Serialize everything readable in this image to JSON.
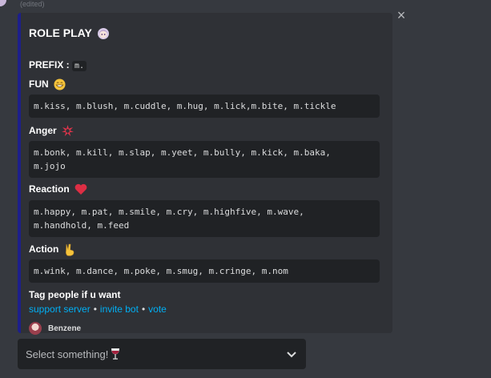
{
  "message": {
    "edited_label": "(edited)"
  },
  "embed": {
    "title": "ROLE PLAY",
    "prefix_label": "PREFIX :",
    "prefix_value": "m.",
    "fields": [
      {
        "name": "FUN",
        "value": "m.kiss, m.blush, m.cuddle, m.hug, m.lick,m.bite, m.tickle",
        "icon": "grinning-face-icon"
      },
      {
        "name": "Anger",
        "value": "m.bonk, m.kill, m.slap, m.yeet, m.bully, m.kick, m.baka,\nm.jojo",
        "icon": "anger-symbol-icon"
      },
      {
        "name": "Reaction",
        "value": "m.happy, m.pat, m.smile, m.cry, m.highfive, m.wave,\nm.handhold, m.feed",
        "icon": "red-heart-icon"
      },
      {
        "name": "Action",
        "value": "m.wink, m.dance, m.poke, m.smug, m.cringe, m.nom",
        "icon": "victory-hand-icon"
      }
    ],
    "tag_text": "Tag people if u want",
    "links": {
      "support": "support server",
      "sep1": "•",
      "invite": "invite bot",
      "sep2": "•",
      "vote": "vote"
    },
    "footer": {
      "author": "Benzene"
    },
    "accent_color": "#1d1f8a"
  },
  "select": {
    "placeholder": "Select something!",
    "icon": "wine-glass-icon"
  }
}
